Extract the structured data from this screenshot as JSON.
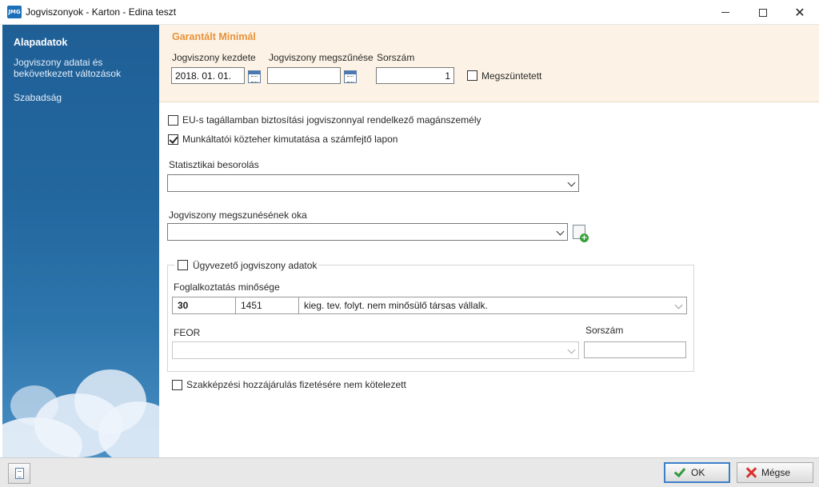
{
  "window": {
    "title": "Jogviszonyok - Karton  - Edina teszt",
    "app_icon_text": "JMG"
  },
  "sidebar": {
    "items": [
      {
        "label": "Alapadatok",
        "active": true
      },
      {
        "label": "Jogviszony adatai és bekövetkezett változások",
        "active": false
      },
      {
        "label": "Szabadság",
        "active": false
      }
    ]
  },
  "header": {
    "title": "Garantált Minimál",
    "start_label": "Jogviszony kezdete",
    "start_value": "2018. 01. 01.",
    "end_label": "Jogviszony megszűnése",
    "end_value": "",
    "serial_label": "Sorszám",
    "serial_value": "1",
    "terminated_label": "Megszüntetett",
    "terminated_checked": false
  },
  "form": {
    "eu_label": "EU-s tagállamban biztosítási jogviszonnyal rendelkező magánszemély",
    "eu_checked": false,
    "employer_label": "Munkáltatói közteher kimutatása a számfejtő lapon",
    "employer_checked": true,
    "stat_label": "Statisztikai besorolás",
    "stat_value": "",
    "termination_reason_label": "Jogviszony megszunésének oka",
    "termination_reason_value": "",
    "managing_label": "Ügyvezető jogviszony adatok",
    "managing_checked": false,
    "employment_quality_label": "Foglalkoztatás minősége",
    "employment_quality": {
      "code": "30",
      "number": "1451",
      "description": "kieg. tev. folyt. nem minősülő társas vállalk."
    },
    "feor_label": "FEOR",
    "feor_value": "",
    "feor_serial_label": "Sorszám",
    "feor_serial_value": "",
    "vocational_label": "Szakképzési hozzájárulás fizetésére nem kötelezett",
    "vocational_checked": false
  },
  "footer": {
    "ok_label": "OK",
    "cancel_label": "Mégse"
  },
  "colors": {
    "sidebar": "#23679f",
    "header_bg": "#fcf3e6",
    "header_title": "#e8923a",
    "ok_border": "#3c7fc8"
  }
}
